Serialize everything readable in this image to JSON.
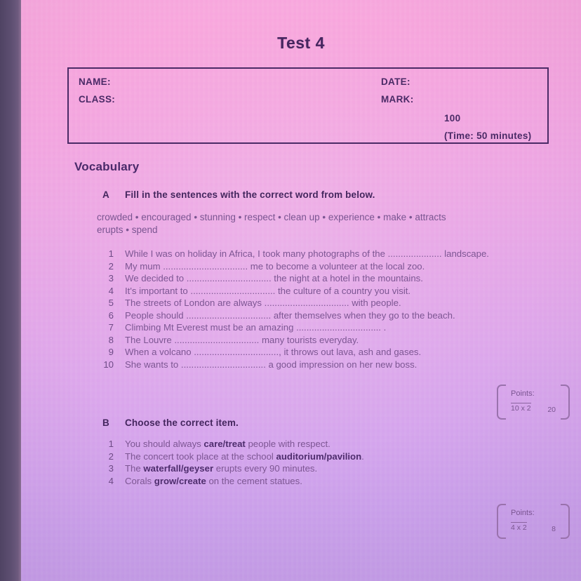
{
  "document": {
    "title": "Test 4"
  },
  "header_box": {
    "name_label": "NAME:",
    "class_label": "CLASS:",
    "date_label": "DATE:",
    "mark_label": "MARK:",
    "total_marks": "100",
    "time_note": "(Time: 50 minutes)"
  },
  "section": {
    "heading": "Vocabulary"
  },
  "exercise_a": {
    "letter": "A",
    "instruction": "Fill in the sentences with the correct word from below.",
    "word_bank_line_1": "crowded • encouraged • stunning • respect • clean up • experience • make • attracts",
    "word_bank_line_2": "erupts • spend",
    "word_bank": [
      "crowded",
      "encouraged",
      "stunning",
      "respect",
      "clean up",
      "experience",
      "make",
      "attracts",
      "erupts",
      "spend"
    ],
    "questions": [
      {
        "num": "1",
        "text": "While I was on holiday in Africa, I took many photographs of the  ..................... landscape."
      },
      {
        "num": "2",
        "text": "My mum ................................. me to become a volunteer at the local zoo."
      },
      {
        "num": "3",
        "text": "We decided to ................................. the night at a hotel in the mountains."
      },
      {
        "num": "4",
        "text": "It's important to ................................. the culture of a country you visit."
      },
      {
        "num": "5",
        "text": "The streets of London are always  ................................. with people."
      },
      {
        "num": "6",
        "text": "People should  ................................. after themselves when they go to the beach."
      },
      {
        "num": "7",
        "text": "Climbing Mt Everest must be an amazing  ................................. ."
      },
      {
        "num": "8",
        "text": "The Louvre ................................. many tourists everyday."
      },
      {
        "num": "9",
        "text": "When a volcano ................................., it throws out lava, ash and gases."
      },
      {
        "num": "10",
        "text": "She wants to ................................. a good impression on her new boss."
      }
    ],
    "points": {
      "label": "Points:",
      "formula": "10 x 2",
      "total": "20"
    }
  },
  "exercise_b": {
    "letter": "B",
    "instruction": "Choose the correct item.",
    "questions": [
      {
        "num": "1",
        "before": "You should always ",
        "choice": "care/treat",
        "after": " people with respect."
      },
      {
        "num": "2",
        "before": "The concert took place at the school ",
        "choice": "auditorium/pavilion",
        "after": "."
      },
      {
        "num": "3",
        "before": "The ",
        "choice": "waterfall/geyser",
        "after": " erupts every 90 minutes."
      },
      {
        "num": "4",
        "before": "Corals ",
        "choice": "grow/create",
        "after": " on the cement statues."
      }
    ],
    "points": {
      "label": "Points:",
      "formula": "4 x 2",
      "total": "8"
    }
  },
  "colors": {
    "ink_dark": "#4a2a66",
    "ink_body": "#7a5591",
    "page_top": "#f9a9dd",
    "page_bottom": "#c49fe9",
    "edge_band": "#5a4a6e"
  }
}
